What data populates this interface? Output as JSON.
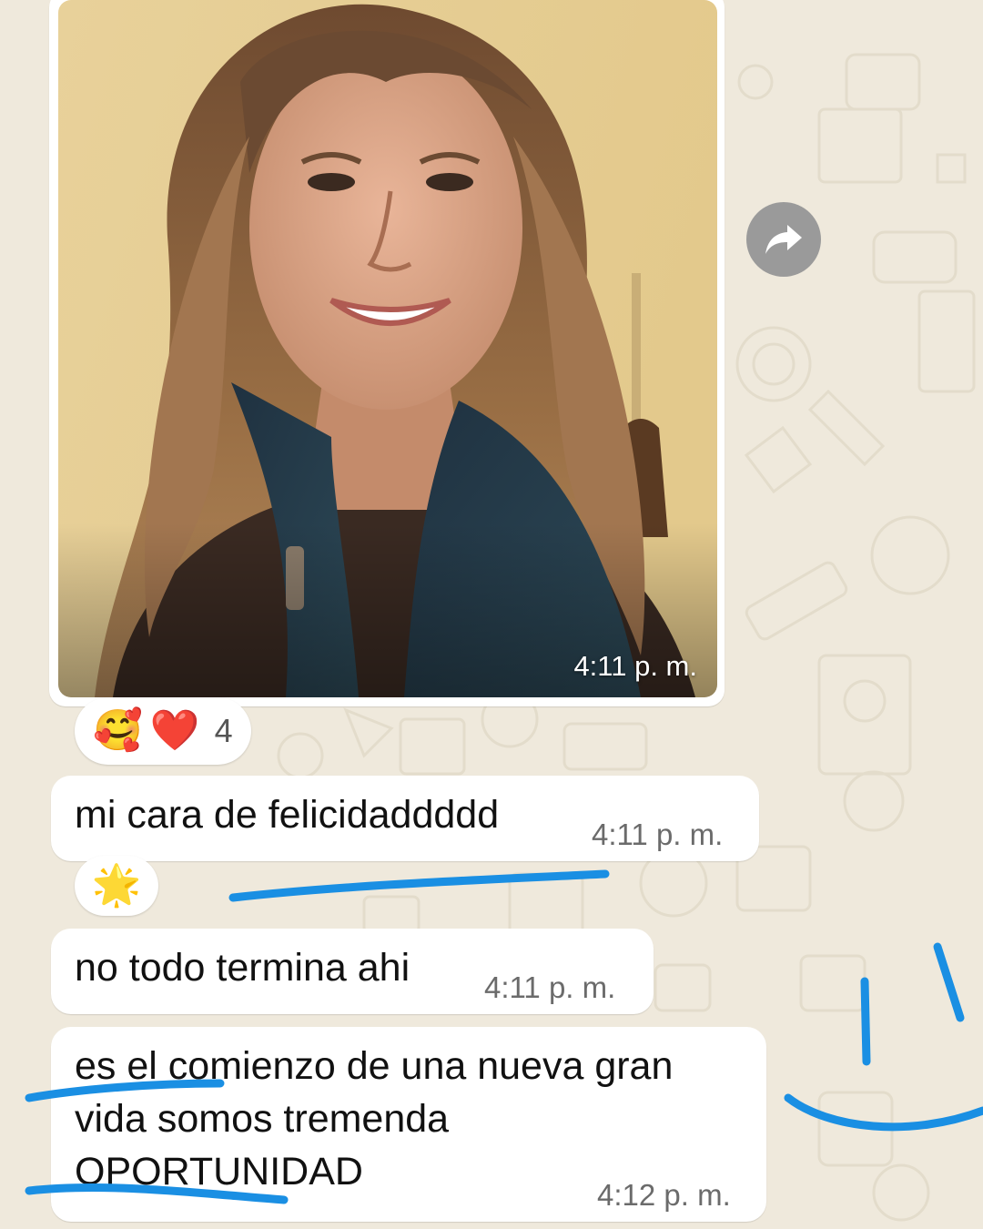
{
  "chat": {
    "photo_message": {
      "time": "4:11 p. m."
    },
    "photo_reactions": {
      "emoji_1": "🥰",
      "emoji_2": "❤️",
      "count": "4"
    },
    "messages": [
      {
        "text": "mi cara de felicidaddddd",
        "time": "4:11 p. m."
      },
      {
        "text": "no todo termina ahi",
        "time": "4:11 p. m."
      },
      {
        "text": "es el comienzo de una nueva gran\nvida somos tremenda\nOPORTUNIDAD",
        "time": "4:12 p. m."
      }
    ],
    "message_reactions": {
      "emoji": "🌟"
    }
  },
  "icons": {
    "forward": "forward-arrow-icon"
  },
  "colors": {
    "wallpaper": "#efe9dc",
    "bubble": "#ffffff",
    "annotation_ink": "#1a8fe3"
  }
}
